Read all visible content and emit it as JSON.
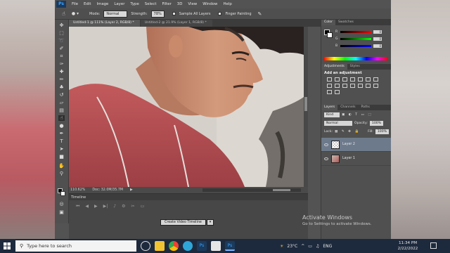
{
  "menubar": {
    "logo": "Ps",
    "items": [
      "File",
      "Edit",
      "Image",
      "Layer",
      "Type",
      "Select",
      "Filter",
      "3D",
      "View",
      "Window",
      "Help"
    ]
  },
  "options": {
    "mode_label": "Mode:",
    "mode_value": "Normal",
    "strength_label": "Strength:",
    "strength_value": "78%",
    "sample_all_layers": "Sample All Layers",
    "finger_painting": "Finger Painting"
  },
  "tabs": [
    {
      "label": "Untitled-1 @ 111% (Layer 2, RGB/8) *",
      "active": true
    },
    {
      "label": "Untitled-2 @ 21.9% (Layer 1, RGB/8) *",
      "active": false
    }
  ],
  "status": {
    "zoom": "110.62%",
    "doc": "Doc: 32.0M/35.7M"
  },
  "timeline": {
    "title": "Timeline",
    "create_button": "Create Video Timeline"
  },
  "panels": {
    "color_tabs": [
      "Color",
      "Swatches"
    ],
    "color_values": {
      "r": "0",
      "g": "0",
      "b": "0"
    },
    "adjust_tabs": [
      "Adjustments",
      "Styles"
    ],
    "adjust_title": "Add an adjustment",
    "layer_tabs": [
      "Layers",
      "Channels",
      "Paths"
    ],
    "kind_label": "Kind",
    "blend_mode": "Normal",
    "opacity_label": "Opacity:",
    "opacity_value": "100%",
    "lock_label": "Lock:",
    "fill_label": "Fill:",
    "fill_value": "100%",
    "layers": [
      {
        "name": "Layer 2",
        "selected": true
      },
      {
        "name": "Layer 1",
        "selected": false
      }
    ]
  },
  "watermark": {
    "line1": "Activate Windows",
    "line2": "Go to Settings to activate Windows."
  },
  "taskbar": {
    "search_placeholder": "Type here to search",
    "weather": "23°C",
    "language": "ENG",
    "time": "11:34 PM",
    "date": "2/22/2022"
  }
}
